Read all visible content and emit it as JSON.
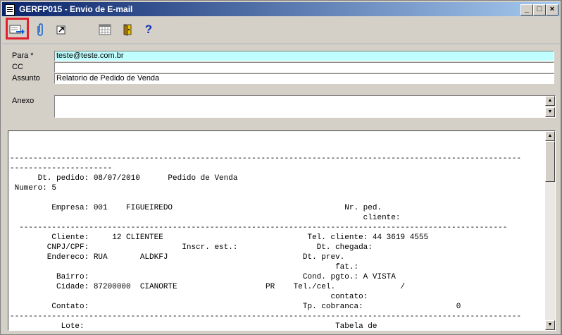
{
  "window": {
    "title": "GERFP015 - Envio de E-mail"
  },
  "titlebar_buttons": {
    "minimize": "_",
    "maximize": "□",
    "close": "×"
  },
  "toolbar": {
    "tools": [
      {
        "name": "send-email-icon"
      },
      {
        "name": "attach-icon"
      },
      {
        "name": "export-icon"
      },
      {
        "name": "calendar-grid-icon"
      },
      {
        "name": "exit-door-icon"
      },
      {
        "name": "help-icon",
        "glyph": "?"
      }
    ]
  },
  "form": {
    "to_label": "Para *",
    "to_value": "teste@teste.com.br",
    "cc_label": "CC",
    "cc_value": "",
    "subject_label": "Assunto",
    "subject_value": "Relatorio de Pedido de Venda",
    "annex_label": "Anexo"
  },
  "report": {
    "lines": [
      "",
      "",
      "--------------------------------------------------------------------------------------------------------------",
      "----------------------",
      "      Dt. pedido: 08/07/2010      Pedido de Venda",
      " Numero: 5",
      "",
      "         Empresa: 001    FIGUEIREDO                                     Nr. ped.",
      "                                                                            cliente:",
      "  ---------------------------------------------------------------------------------------------------------",
      "         Cliente:     12 CLIENTEE                               Tel. cliente: 44 3619 4555",
      "        CNPJ/CPF:                    Inscr. est.:                 Dt. chegada:",
      "        Endereco: RUA       ALDKFJ                             Dt. prev.",
      "                                                                      fat.:",
      "          Bairro:                                              Cond. pgto.: A VISTA",
      "          Cidade: 87200000  CIANORTE                   PR    Tel./cel.              /",
      "                                                                     contato:",
      "         Contato:                                              Tp. cobranca:                    0",
      "--------------------------------------------------------------------------------------------------------------",
      "           Lote:                                                      Tabela de"
    ]
  },
  "colors": {
    "active_field": "#c0ffff",
    "highlight": "#e0202b",
    "title_start": "#0a246a",
    "title_end": "#a6caf0"
  }
}
